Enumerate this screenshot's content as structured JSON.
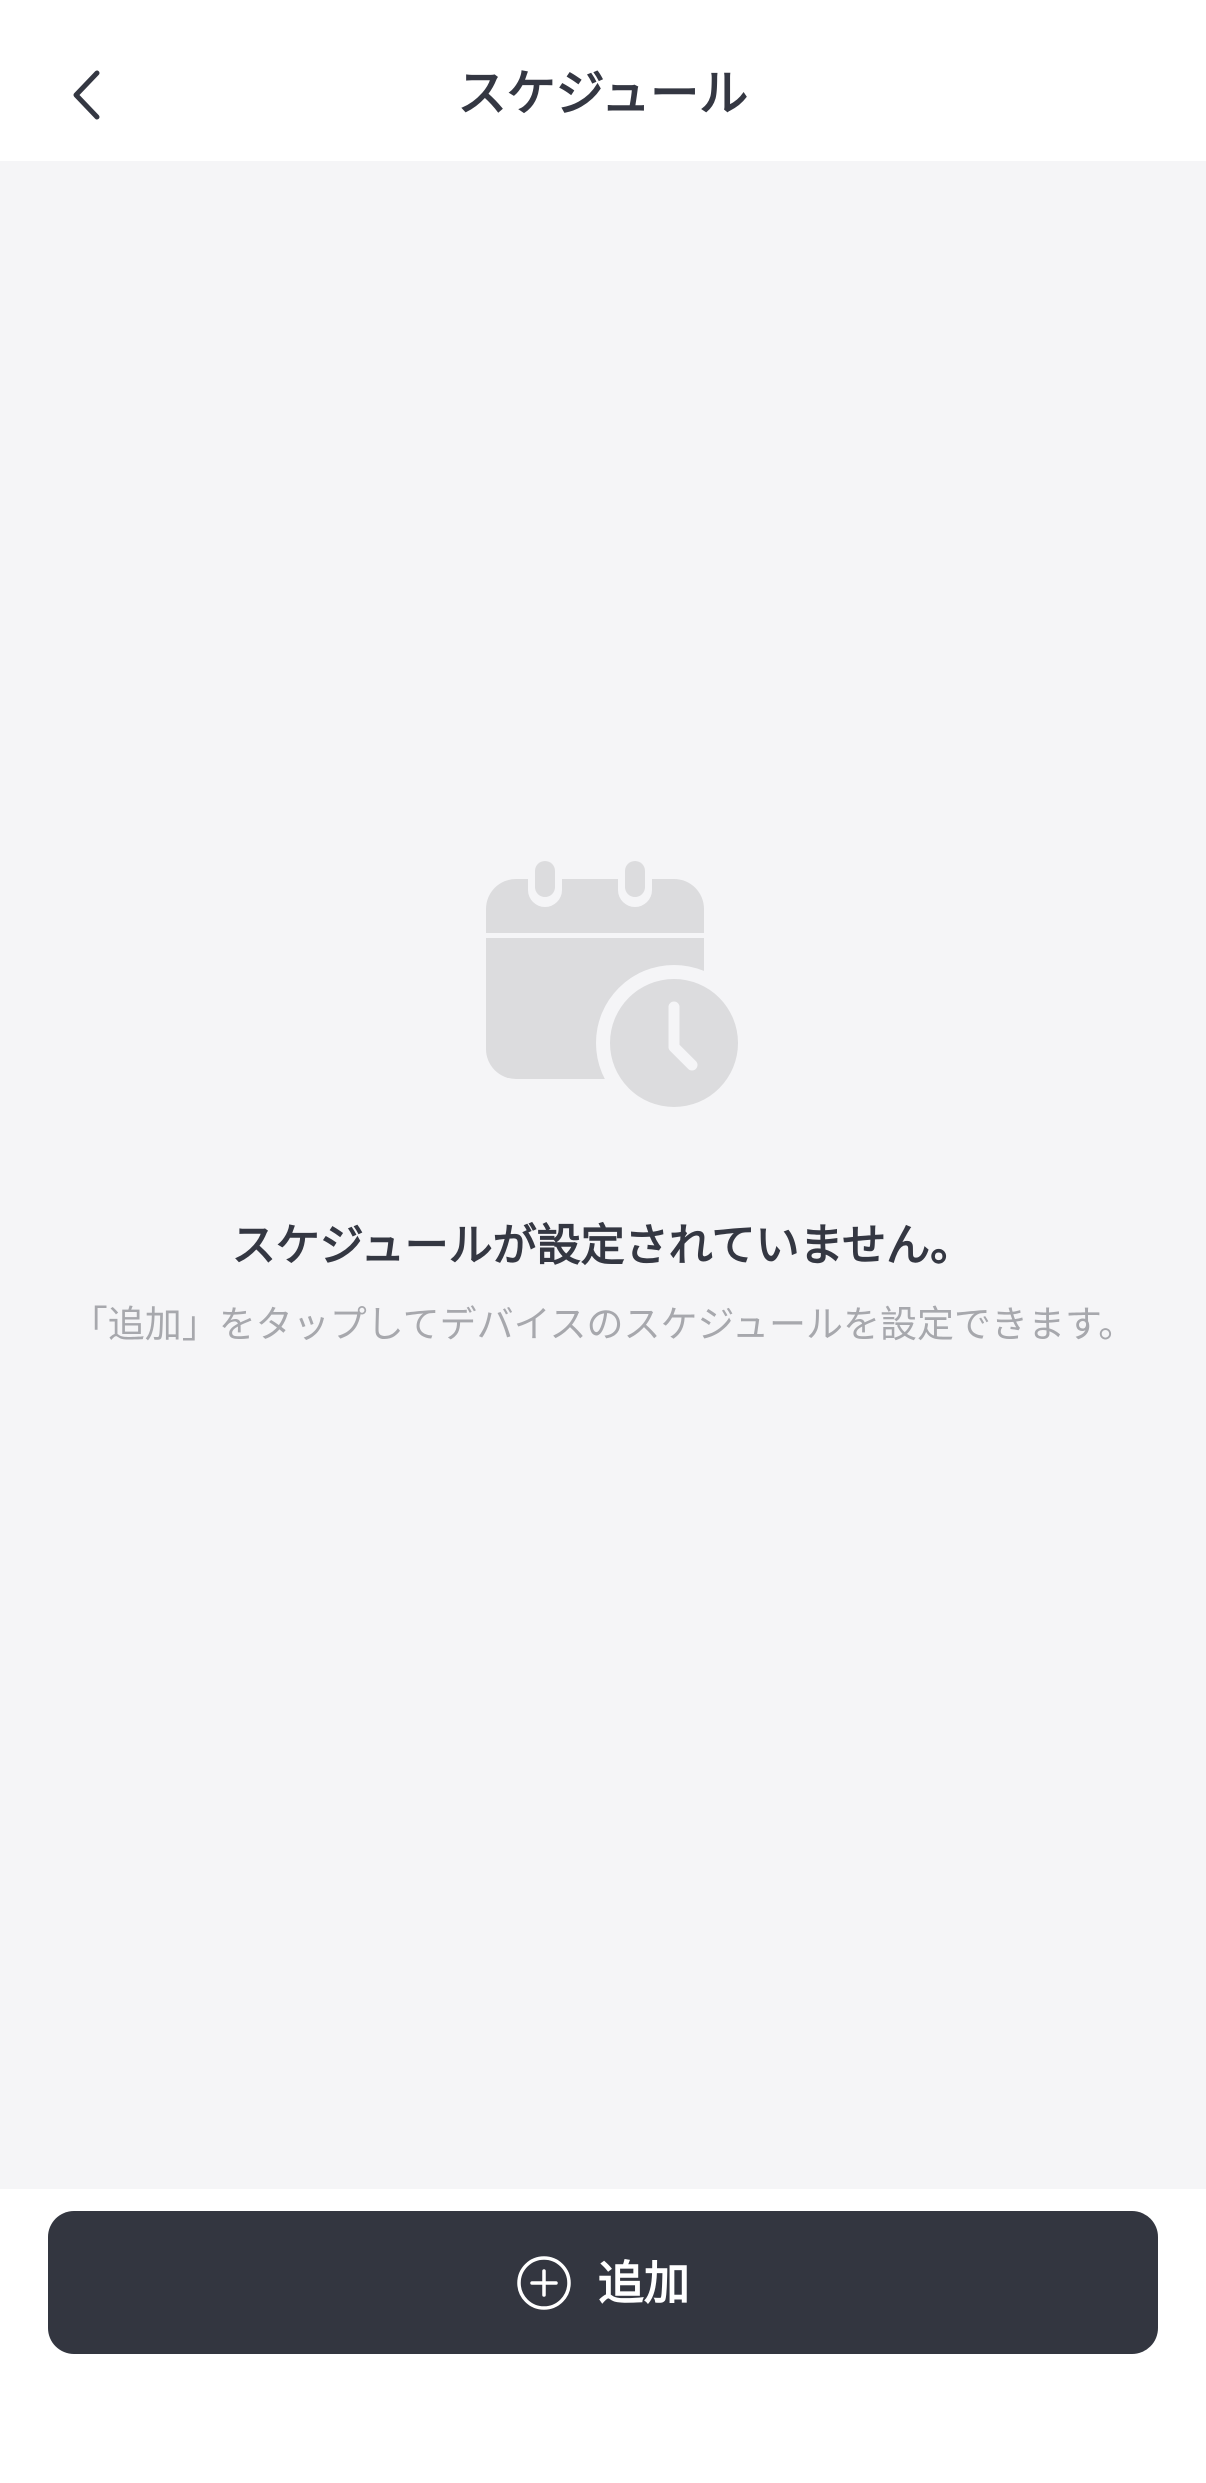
{
  "header": {
    "back_icon": "chevron-left-icon",
    "title": "スケジュール"
  },
  "empty_state": {
    "icon": "calendar-clock-icon",
    "title": "スケジュールが設定されていません。",
    "description": "「追加」をタップしてデバイスのスケジュールを設定できます。"
  },
  "footer": {
    "add_button_icon": "plus-circle-icon",
    "add_button_label": "追加"
  },
  "colors": {
    "background": "#f5f5f7",
    "text_primary": "#343742",
    "text_secondary": "#a7a8ad",
    "icon_gray": "#dcdcde",
    "button_bg": "#333640",
    "button_text": "#ffffff"
  }
}
